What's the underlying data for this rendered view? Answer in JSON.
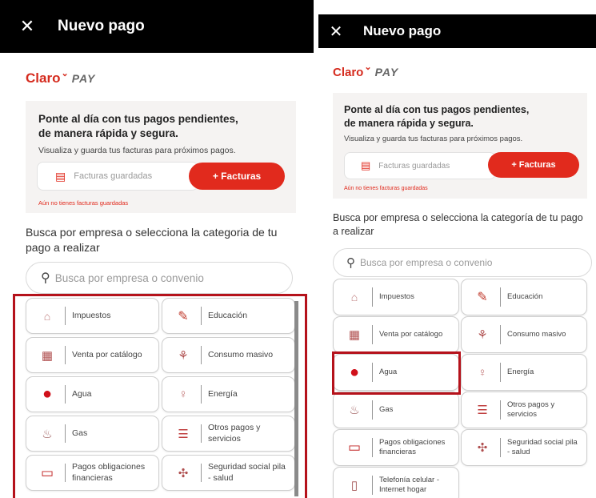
{
  "left": {
    "header": {
      "close_icon": "close-icon",
      "title": "Nuevo pago"
    },
    "logo": {
      "claro": "Claro",
      "pay": "PAY"
    },
    "banner": {
      "title_line1": "Ponte al día con tus pagos pendientes,",
      "title_line2": "de manera rápida y segura.",
      "subtitle": "Visualiza y guarda tus facturas para próximos pagos.",
      "saved_label": "Facturas guardadas",
      "button_label": "+ Facturas",
      "warning": "Aún no tienes facturas guardadas"
    },
    "prompt": "Busca por empresa o selecciona la categoria de tu pago a realizar",
    "search": {
      "placeholder": "Busca por empresa o convenio"
    },
    "categories": [
      {
        "label": "Impuestos",
        "icon": "landmark-icon"
      },
      {
        "label": "Educación",
        "icon": "pencil-icon"
      },
      {
        "label": "Venta por catálogo",
        "icon": "catalog-icon"
      },
      {
        "label": "Consumo masivo",
        "icon": "basket-icon"
      },
      {
        "label": "Agua",
        "icon": "water-drop-icon"
      },
      {
        "label": "Energía",
        "icon": "lightbulb-icon"
      },
      {
        "label": "Gas",
        "icon": "flame-icon"
      },
      {
        "label": "Otros pagos y servicios",
        "icon": "list-icon"
      },
      {
        "label": "Pagos obligaciones financieras",
        "icon": "card-icon"
      },
      {
        "label": "Seguridad social pila - salud",
        "icon": "health-icon"
      }
    ]
  },
  "right": {
    "header": {
      "close_icon": "close-icon",
      "title": "Nuevo pago"
    },
    "logo": {
      "claro": "Claro",
      "pay": "PAY"
    },
    "banner": {
      "title_line1": "Ponte al día con tus pagos pendientes,",
      "title_line2": "de manera rápida y segura.",
      "subtitle": "Visualiza y guarda tus facturas para próximos pagos.",
      "saved_label": "Facturas guardadas",
      "button_label": "+ Facturas",
      "warning": "Aún no tienes facturas guardadas"
    },
    "prompt": "Busca por empresa o selecciona la categoría de tu pago a realizar",
    "search": {
      "placeholder": "Busca por empresa o convenio"
    },
    "categories": [
      {
        "label": "Impuestos",
        "icon": "landmark-icon"
      },
      {
        "label": "Educación",
        "icon": "pencil-icon"
      },
      {
        "label": "Venta por catálogo",
        "icon": "catalog-icon"
      },
      {
        "label": "Consumo masivo",
        "icon": "basket-icon"
      },
      {
        "label": "Agua",
        "icon": "water-drop-icon"
      },
      {
        "label": "Energía",
        "icon": "lightbulb-icon"
      },
      {
        "label": "Gas",
        "icon": "flame-icon"
      },
      {
        "label": "Otros pagos y servicios",
        "icon": "list-icon"
      },
      {
        "label": "Pagos obligaciones financieras",
        "icon": "card-icon"
      },
      {
        "label": "Seguridad social pila - salud",
        "icon": "health-icon"
      },
      {
        "label": "Telefonía celular - Internet hogar",
        "icon": "phone-icon"
      }
    ]
  },
  "colors": {
    "accent": "#e12a1d",
    "highlight": "#b5121b",
    "header": "#000000"
  }
}
